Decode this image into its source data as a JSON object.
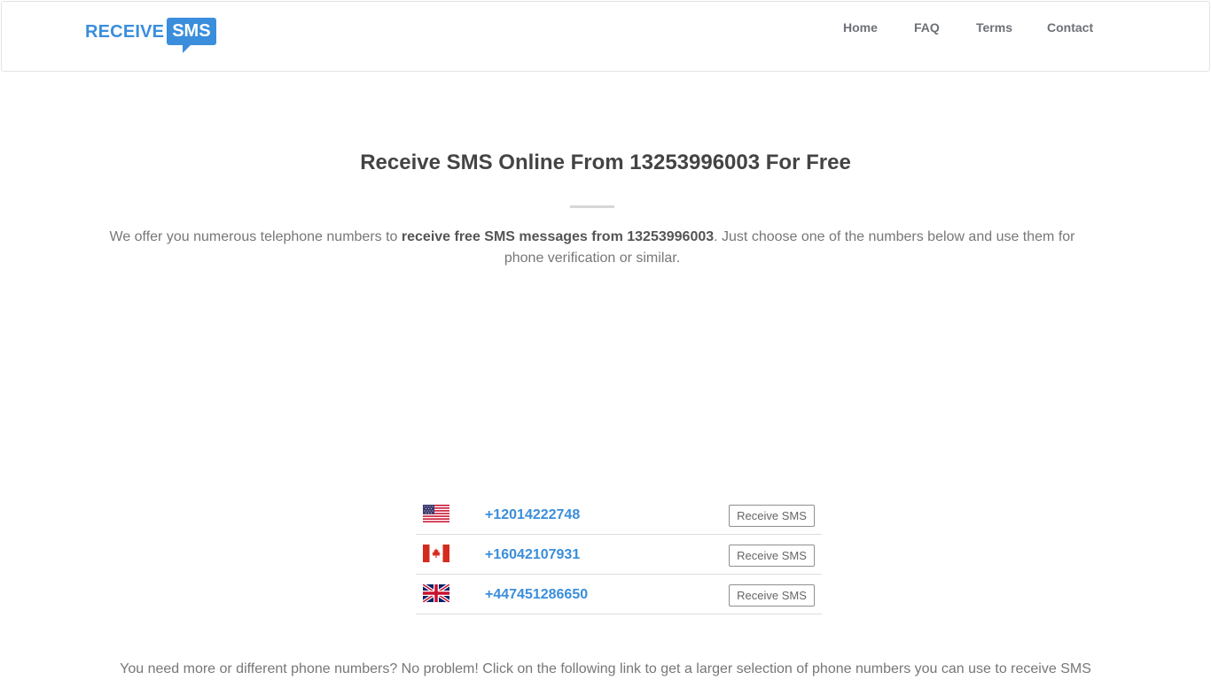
{
  "logo": {
    "word": "RECEIVE",
    "bubble": "SMS"
  },
  "nav": {
    "home": "Home",
    "faq": "FAQ",
    "terms": "Terms",
    "contact": "Contact"
  },
  "main": {
    "title": "Receive SMS Online From 13253996003 For Free",
    "intro_before": "We offer you numerous telephone numbers to ",
    "intro_bold": "receive free SMS messages from 13253996003",
    "intro_after": ". Just choose one of the numbers below and use them for phone verification or similar."
  },
  "numbers": [
    {
      "country_flag": "us-flag-icon",
      "phone": "+12014222748",
      "button": "Receive SMS"
    },
    {
      "country_flag": "ca-flag-icon",
      "phone": "+16042107931",
      "button": "Receive SMS"
    },
    {
      "country_flag": "gb-flag-icon",
      "phone": "+447451286650",
      "button": "Receive SMS"
    }
  ],
  "outro": "You need more or different phone numbers? No problem! Click on the following link to get a larger selection of phone numbers you can use to receive SMS",
  "colors": {
    "brand": "#3a8edb",
    "heading": "#444444",
    "text": "#777777"
  }
}
